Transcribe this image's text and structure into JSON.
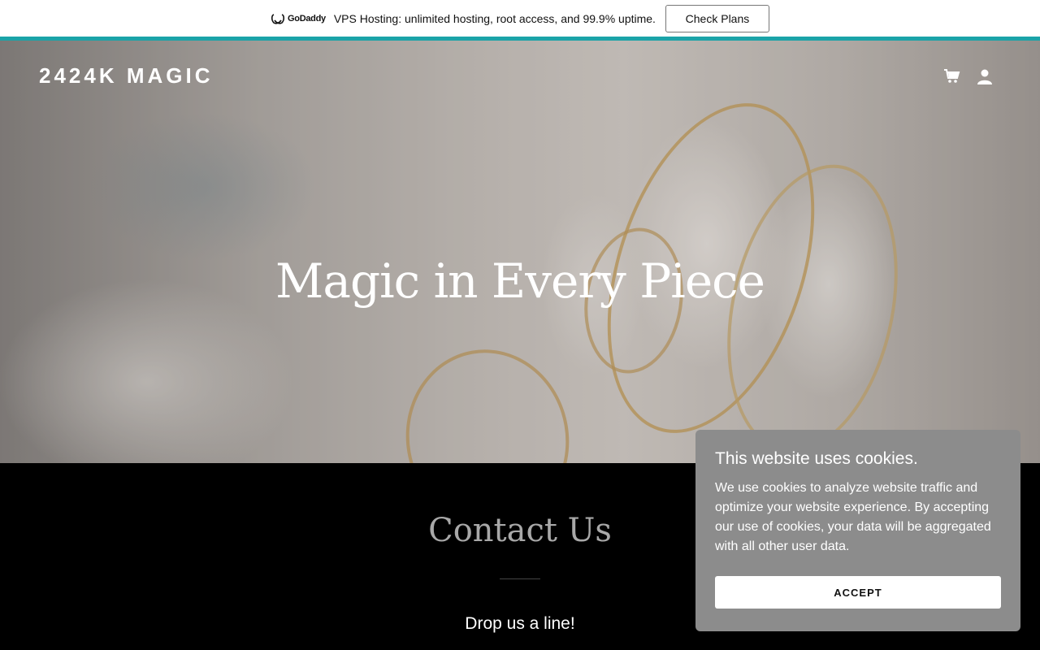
{
  "promo": {
    "logo_text": "GoDaddy",
    "message": "VPS Hosting: unlimited hosting, root access, and 99.9% uptime.",
    "cta_label": "Check Plans",
    "accent_color": "#1ba3a8"
  },
  "header": {
    "brand": "2424K MAGIC",
    "icons": [
      "cart-icon",
      "account-icon"
    ]
  },
  "hero": {
    "title": "Magic in Every Piece"
  },
  "contact": {
    "title": "Contact Us",
    "subtitle": "Drop us a line!"
  },
  "cookie_banner": {
    "title": "This website uses cookies.",
    "body": "We use cookies to analyze website traffic and optimize your website experience. By accepting our use of cookies, your data will be aggregated with all other user data.",
    "accept_label": "ACCEPT"
  }
}
